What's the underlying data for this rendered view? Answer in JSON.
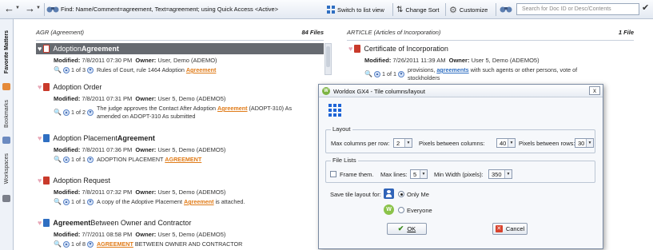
{
  "toolbar": {
    "find_text": "Find: Name/Comment=agreement, Text=agreement; using Quick Access <Active>",
    "switch_view_label": "Switch to list view",
    "change_sort_label": "Change Sort",
    "customize_label": "Customize",
    "search_placeholder": "Search for Doc ID or Desc/Contents"
  },
  "sidebar": {
    "tabs": [
      {
        "label": "Favorite Matters"
      },
      {
        "label": "Bookmarks"
      },
      {
        "label": "Workspaces"
      }
    ]
  },
  "left_column": {
    "header_abbr": "AGR",
    "header_name": "(Agreement)",
    "file_count": "84 Files",
    "files": [
      {
        "title_a": "Adoption ",
        "title_b": "Agreement",
        "modified": "7/8/2011 07:30 PM",
        "owner": "User, Demo (ADEMO)",
        "hit_count": "1 of 3",
        "hit_pre": "Rules of Court, rule 1464 Adoption ",
        "hit_kw": "Agreement",
        "hit_post": ""
      },
      {
        "title_a": "Adoption Order",
        "title_b": "",
        "modified": "7/8/2011 07:31 PM",
        "owner": "User 5, Demo (ADEMO5)",
        "hit_count": "1 of 2",
        "hit_pre": "The judge approves the Contact After Adoption ",
        "hit_kw": "Agreement",
        "hit_post": " (ADOPT-310) As amended on ADOPT-310 As submitted"
      },
      {
        "title_a": "Adoption Placement ",
        "title_b": "Agreement",
        "modified": "7/8/2011 07:36 PM",
        "owner": "User 5, Demo (ADEMO5)",
        "hit_count": "1 of 1",
        "hit_pre": "ADOPTION PLACEMENT ",
        "hit_kw": "AGREEMENT",
        "hit_post": ""
      },
      {
        "title_a": "Adoption Request",
        "title_b": "",
        "modified": "7/8/2011 07:32 PM",
        "owner": "User 5, Demo (ADEMO5)",
        "hit_count": "1 of 1",
        "hit_pre": "A copy of the Adoptive Placement ",
        "hit_kw": "Agreement",
        "hit_post": " is attached."
      },
      {
        "title_a": "",
        "title_b": "Agreement",
        "title_c": " Between Owner and Contractor",
        "modified": "7/7/2011 08:58 PM",
        "owner": "User 5, Demo (ADEMO5)",
        "hit_count": "1 of 8",
        "hit_pre": "",
        "hit_kw": "AGREEMENT",
        "hit_post": " BETWEEN OWNER AND CONTRACTOR"
      }
    ]
  },
  "right_column": {
    "header_abbr": "ARTICLE",
    "header_name": "(Articles of Incorporation)",
    "file_count": "1 File",
    "files": [
      {
        "title": "Certificate of Incorporation",
        "modified": "7/26/2011 11:39 AM",
        "owner": "User 5, Demo (ADEMO5)",
        "hit_count": "1 of 1",
        "hit_pre": "provisions, ",
        "hit_kw": "agreements",
        "hit_post": " with such agents or other persons, vote of stockholders"
      }
    ]
  },
  "labels": {
    "modified": "Modified:",
    "owner": "Owner:"
  },
  "dialog": {
    "title": "Worldox GX4 - Tile columns/layout",
    "close": "x",
    "layout_group": "Layout",
    "max_columns_label": "Max columns per row:",
    "max_columns_value": "2",
    "pixels_columns_label": "Pixels between columns:",
    "pixels_columns_value": "40",
    "pixels_rows_label": "Pixels between rows:",
    "pixels_rows_value": "30",
    "file_lists_group": "File Lists",
    "frame_label": "Frame them.",
    "max_lines_label": "Max lines:",
    "max_lines_value": "5",
    "min_width_label": "Min Width (pixels):",
    "min_width_value": "350",
    "save_layout_label": "Save tile layout for:",
    "only_me_label": "Only Me",
    "everyone_label": "Everyone",
    "ok_label": "OK",
    "cancel_label": "Cancel"
  },
  "colors": {
    "keyword": "#e07b18",
    "selected_row": "#666a70",
    "grid_icon": "#1e64d6"
  }
}
